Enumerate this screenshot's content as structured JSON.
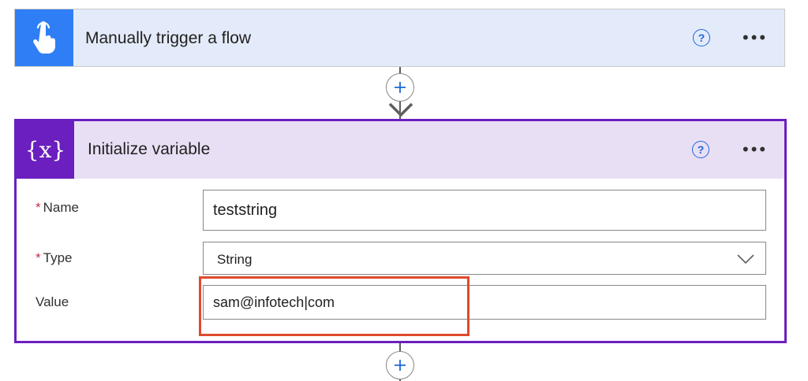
{
  "trigger_card": {
    "title": "Manually trigger a flow",
    "icon": "touch-hand-icon",
    "help_label": "?",
    "more_label": "•••"
  },
  "variable_card": {
    "title": "Initialize variable",
    "icon_text": "{x}",
    "help_label": "?",
    "more_label": "•••",
    "fields": {
      "name": {
        "required_mark": "*",
        "label": "Name",
        "value": "teststring"
      },
      "type": {
        "required_mark": "*",
        "label": "Type",
        "value": "String"
      },
      "value": {
        "label": "Value",
        "value": "sam@infotech|com"
      }
    }
  },
  "colors": {
    "trigger_accent": "#2f7ef6",
    "trigger_header": "#e3ebfa",
    "variable_accent": "#6b1fbf",
    "variable_header": "#e9dff5",
    "highlight": "#e04a2b",
    "link_blue": "#1d68d6"
  }
}
